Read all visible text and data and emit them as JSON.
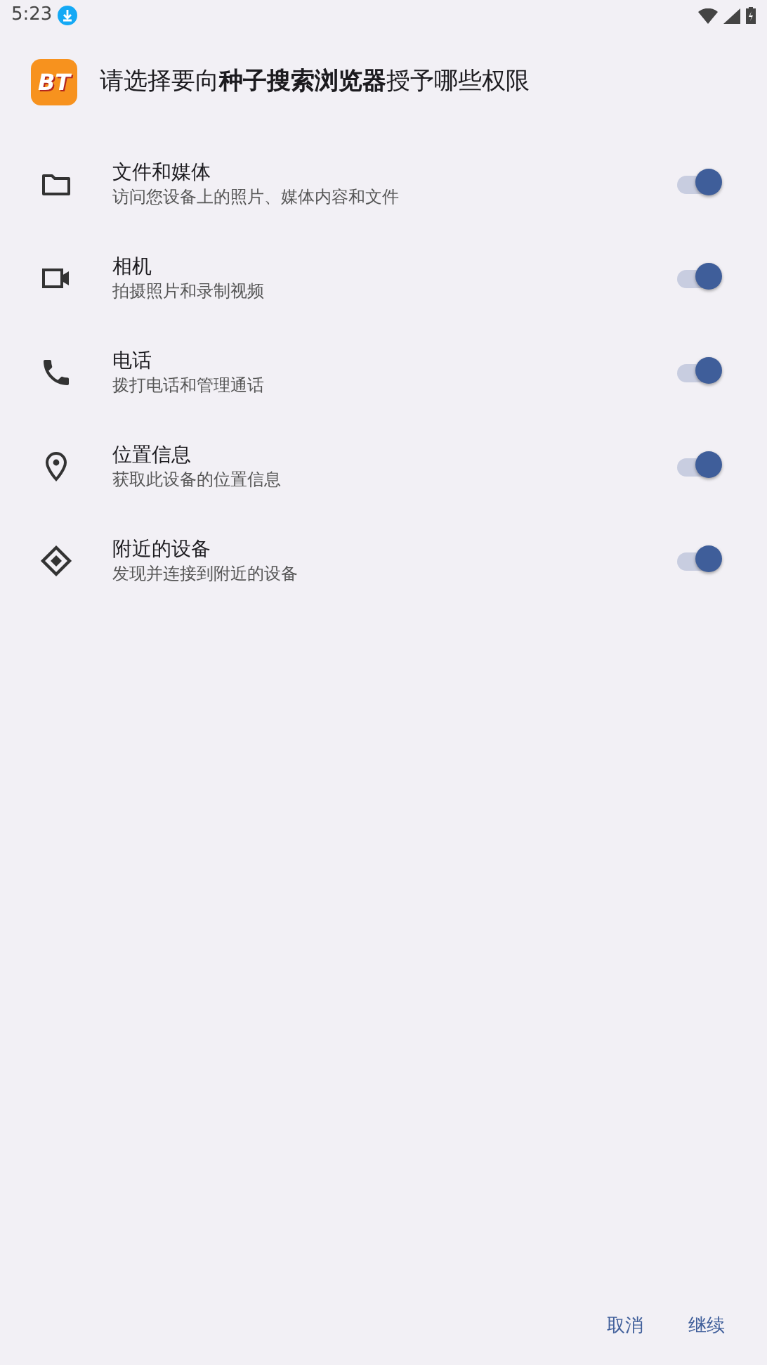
{
  "status_bar": {
    "time": "5:23"
  },
  "dialog": {
    "app_icon_text": "BT",
    "title": "请选择要向**种子搜索浏览器**授予哪些权限",
    "permissions": [
      {
        "kind": "folder",
        "name": "文件和媒体",
        "description": "访问您设备上的照片、媒体内容和文件",
        "on": true
      },
      {
        "kind": "camera",
        "name": "相机",
        "description": "拍摄照片和录制视频",
        "on": true
      },
      {
        "kind": "phone",
        "name": "电话",
        "description": "拨打电话和管理通话",
        "on": true
      },
      {
        "kind": "location",
        "name": "位置信息",
        "description": "获取此设备的位置信息",
        "on": true
      },
      {
        "kind": "nearby",
        "name": "附近的设备",
        "description": "发现并连接到附近的设备",
        "on": true
      }
    ],
    "buttons": [
      "取消",
      "继续"
    ]
  }
}
